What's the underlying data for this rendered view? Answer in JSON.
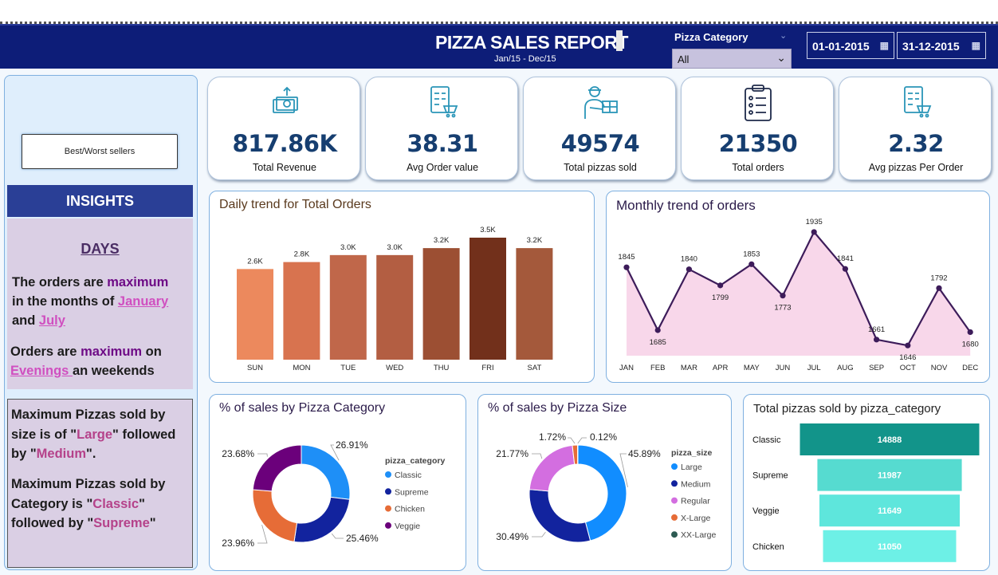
{
  "header": {
    "title": "PIZZA SALES REPORT",
    "subtitle": "Jan/15 - Dec/15",
    "filter_label": "Pizza Category",
    "filter_value": "All",
    "date_from": "01-01-2015",
    "date_to": "31-12-2015"
  },
  "sidebar": {
    "button_label": "Best/Worst sellers",
    "insights_title": "INSIGHTS",
    "days_title": "DAYS",
    "line1": {
      "pre": "The orders are ",
      "hl": "maximum",
      "mid": "in the months of ",
      "lk1": "January ",
      "and": "and ",
      "lk2": "July"
    },
    "line2": {
      "pre": "Orders are ",
      "hl": "maximum",
      "on": " on",
      "lk": "Evenings ",
      "post": "an weekends"
    },
    "size": {
      "p1": "Maximum Pizzas sold by size is of \"",
      "hl1": "Large",
      "p2": "\" followed by \"",
      "hl2": "Medium",
      "p3": "\"."
    },
    "category": {
      "p1": "Maximum Pizzas sold by Category is \"",
      "hl1": "Classic",
      "p2": "\" followed by \"",
      "hl2": "Supreme",
      "p3": "\""
    }
  },
  "kpis": [
    {
      "value": "817.86K",
      "label": "Total Revenue",
      "icon": "money-icon"
    },
    {
      "value": "38.31",
      "label": "Avg Order value",
      "icon": "order-checklist-icon"
    },
    {
      "value": "49574",
      "label": "Total pizzas sold",
      "icon": "delivery-person-icon"
    },
    {
      "value": "21350",
      "label": "Total orders",
      "icon": "clipboard-icon"
    },
    {
      "value": "2.32",
      "label": "Avg pizzas Per Order",
      "icon": "cart-checklist-icon"
    }
  ],
  "colors": {
    "header": "#0d1d78",
    "line": "#3d1c5a",
    "area": "#f8d7ea",
    "donut_category": [
      "#1e8ff7",
      "#12239e",
      "#e66c37",
      "#6b007b"
    ],
    "donut_size": [
      "#118dff",
      "#12239e",
      "#d36ee0",
      "#e66c37",
      "#2d5a52"
    ],
    "funnel": [
      "#12948a",
      "#56dbd0",
      "#5ee6dc",
      "#6df0e6"
    ]
  },
  "chart_data": [
    {
      "type": "bar",
      "title": "Daily trend for Total Orders",
      "categories": [
        "SUN",
        "MON",
        "TUE",
        "WED",
        "THU",
        "FRI",
        "SAT"
      ],
      "values": [
        2.6,
        2.8,
        3.0,
        3.0,
        3.2,
        3.5,
        3.2
      ],
      "labels": [
        "2.6K",
        "2.8K",
        "3.0K",
        "3.0K",
        "3.2K",
        "3.5K",
        "3.2K"
      ],
      "colors": [
        "#ec895d",
        "#d8734f",
        "#c0674a",
        "#b35e42",
        "#9c4f33",
        "#72301b",
        "#a4593b"
      ],
      "ylim": [
        0,
        3.5
      ]
    },
    {
      "type": "area",
      "title": "Monthly trend of orders",
      "categories": [
        "JAN",
        "FEB",
        "MAR",
        "APR",
        "MAY",
        "JUN",
        "JUL",
        "AUG",
        "SEP",
        "OCT",
        "NOV",
        "DEC"
      ],
      "values": [
        1845,
        1685,
        1840,
        1799,
        1853,
        1773,
        1935,
        1841,
        1661,
        1646,
        1792,
        1680
      ],
      "ylim": [
        1620,
        1945
      ]
    },
    {
      "type": "pie",
      "title": "% of sales by Pizza Category",
      "legend_title": "pizza_category",
      "categories": [
        "Classic",
        "Supreme",
        "Chicken",
        "Veggie"
      ],
      "values": [
        26.91,
        25.46,
        23.96,
        23.68
      ],
      "labels": [
        "26.91%",
        "25.46%",
        "23.96%",
        "23.68%"
      ]
    },
    {
      "type": "pie",
      "title": "% of sales by Pizza Size",
      "legend_title": "pizza_size",
      "categories": [
        "Large",
        "Medium",
        "Regular",
        "X-Large",
        "XX-Large"
      ],
      "values": [
        45.89,
        30.49,
        21.77,
        1.72,
        0.12
      ],
      "labels": [
        "45.89%",
        "30.49%",
        "21.77%",
        "1.72%",
        "0.12%"
      ]
    },
    {
      "type": "bar",
      "title": "Total pizzas sold by pizza_category",
      "categories": [
        "Classic",
        "Supreme",
        "Veggie",
        "Chicken"
      ],
      "values": [
        14888,
        11987,
        11649,
        11050
      ],
      "labels": [
        "14888",
        "11987",
        "11649",
        "11050"
      ]
    }
  ]
}
